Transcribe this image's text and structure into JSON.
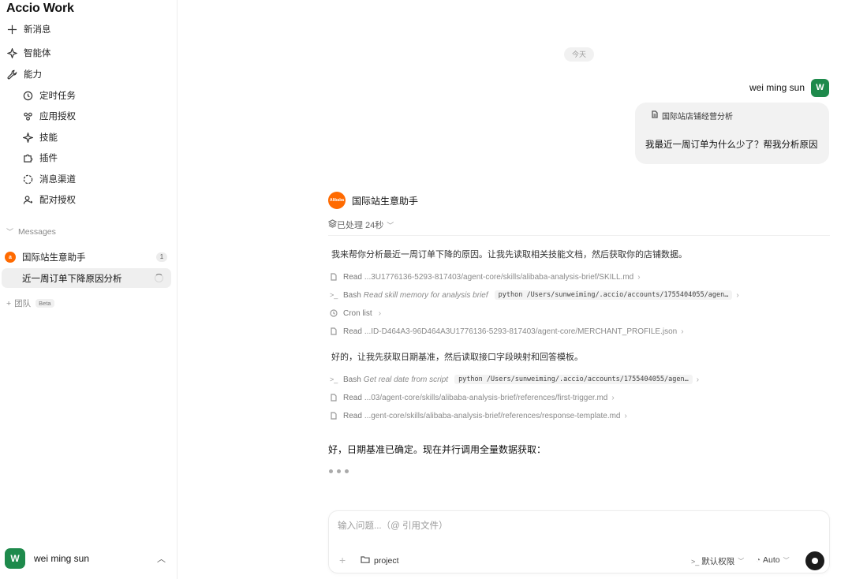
{
  "app": {
    "logo": "Accio Work"
  },
  "sidebar": {
    "nav": [
      {
        "label": "新消息",
        "icon": "plus-icon"
      },
      {
        "label": "智能体",
        "icon": "sparkle-icon"
      },
      {
        "label": "能力",
        "icon": "wrench-icon"
      }
    ],
    "sub": [
      {
        "label": "定时任务",
        "icon": "clock-icon"
      },
      {
        "label": "应用授权",
        "icon": "app-auth-icon"
      },
      {
        "label": "技能",
        "icon": "star-icon"
      },
      {
        "label": "插件",
        "icon": "puzzle-icon"
      },
      {
        "label": "消息渠道",
        "icon": "channel-icon"
      },
      {
        "label": "配对授权",
        "icon": "user-pair-icon"
      }
    ],
    "messages_head": "Messages",
    "group": {
      "name": "国际站生意助手",
      "count": "1"
    },
    "conversation": "近一周订单下降原因分析",
    "team": {
      "label": "团队",
      "beta": "Beta"
    },
    "user": {
      "initial": "W",
      "name": "wei ming sun"
    }
  },
  "chat": {
    "date": "今天",
    "me": {
      "name": "wei ming sun",
      "initial": "W"
    },
    "question": {
      "ref": "国际站店铺经营分析",
      "text": "我最近一周订单为什么少了？帮我分析原因"
    },
    "agent": {
      "name": "国际站生意助手",
      "logo_text": "Alibaba"
    },
    "processed": "已处理 24秒",
    "intro": "我来帮你分析最近一周订单下降的原因。让我先读取相关技能文档，然后获取你的店铺数据。",
    "steps1": [
      {
        "verb": "Read",
        "desc": "",
        "path": "...3U1776136-5293-817403/agent-core/skills/alibaba-analysis-brief/SKILL.md",
        "code": ""
      },
      {
        "verb": "Bash",
        "desc": "Read skill memory for analysis brief",
        "path": "",
        "code": "python /Users/sunweiming/.accio/accounts/1755404055/agen…"
      },
      {
        "verb": "Cron list",
        "desc": "",
        "path": "",
        "code": ""
      },
      {
        "verb": "Read",
        "desc": "",
        "path": "...ID-D464A3-96D464A3U1776136-5293-817403/agent-core/MERCHANT_PROFILE.json",
        "code": ""
      }
    ],
    "mid": "好的，让我先获取日期基准，然后读取接口字段映射和回答模板。",
    "steps2": [
      {
        "verb": "Bash",
        "desc": "Get real date from script",
        "path": "",
        "code": "python /Users/sunweiming/.accio/accounts/1755404055/agen…"
      },
      {
        "verb": "Read",
        "desc": "",
        "path": "...03/agent-core/skills/alibaba-analysis-brief/references/first-trigger.md",
        "code": ""
      },
      {
        "verb": "Read",
        "desc": "",
        "path": "...gent-core/skills/alibaba-analysis-brief/references/response-template.md",
        "code": ""
      }
    ],
    "status": "好，日期基准已确定。现在并行调用全量数据获取："
  },
  "composer": {
    "placeholder": "输入问题...（@ 引用文件）",
    "project": "project",
    "permission": "默认权限",
    "mode": "Auto"
  },
  "colors": {
    "avatar": "#1e8a4c",
    "alibaba": "#ff6a00",
    "send": "#1c1c1c"
  }
}
